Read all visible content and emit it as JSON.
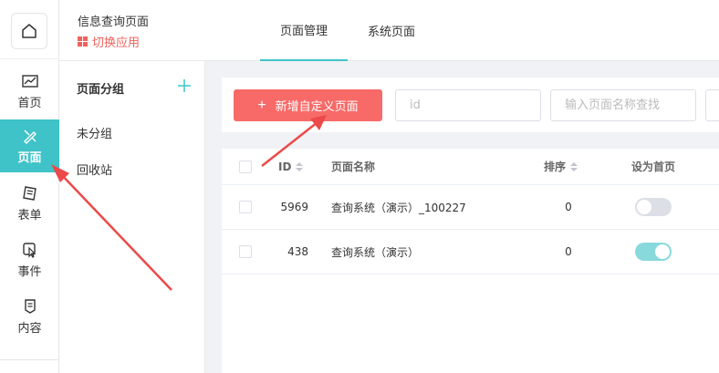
{
  "header": {
    "app_title": "信息查询页面",
    "switch_app_label": "切换应用",
    "tabs": [
      {
        "label": "页面管理",
        "active": true
      },
      {
        "label": "系统页面",
        "active": false
      }
    ]
  },
  "rail": {
    "items": [
      {
        "label": "首页",
        "icon": "chart-icon"
      },
      {
        "label": "页面",
        "icon": "design-icon",
        "active": true
      },
      {
        "label": "表单",
        "icon": "form-icon"
      },
      {
        "label": "事件",
        "icon": "pointer-icon"
      },
      {
        "label": "内容",
        "icon": "document-icon"
      }
    ]
  },
  "groups": {
    "title": "页面分组",
    "items": [
      "未分组",
      "回收站"
    ]
  },
  "toolbar": {
    "new_button_label": "新增自定义页面",
    "id_placeholder": "id",
    "name_placeholder": "输入页面名称查找"
  },
  "table": {
    "headers": {
      "id": "ID",
      "name": "页面名称",
      "sort": "排序",
      "homepage": "设为首页"
    },
    "rows": [
      {
        "id": "5969",
        "name": "查询系统（演示）_100227",
        "sort": "0",
        "homepage": false
      },
      {
        "id": "438",
        "name": "查询系统（演示）",
        "sort": "0",
        "homepage": true
      }
    ]
  },
  "colors": {
    "accent": "#3fc3c8",
    "primary_button": "#f86a68",
    "annotation_arrow": "#ec4a4a"
  }
}
